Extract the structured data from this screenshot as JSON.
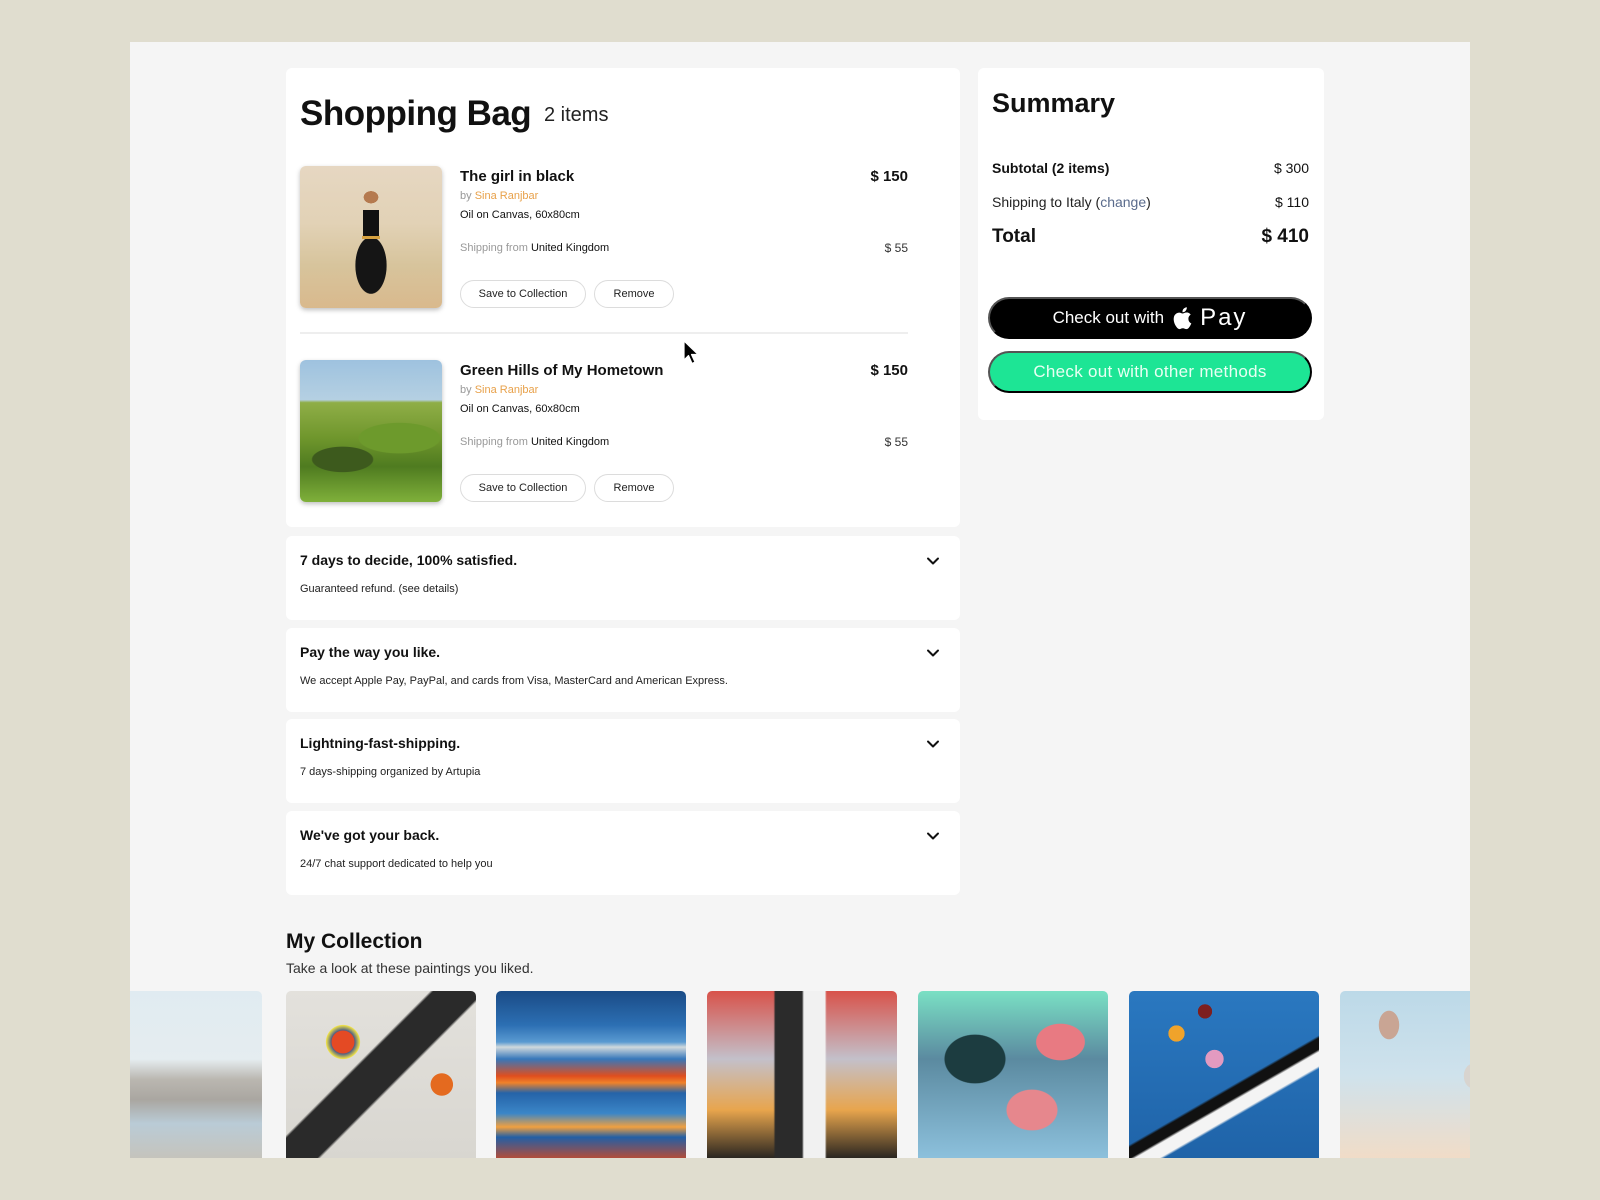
{
  "bag": {
    "title": "Shopping Bag",
    "count": "2 items",
    "items": [
      {
        "title": "The girl in black",
        "by": "by",
        "artist": "Sina Ranjbar",
        "medium": "Oil on Canvas, 60x80cm",
        "shipping_prefix": "Shipping from",
        "shipping_country": "United Kingdom",
        "price": "$ 150",
        "shipping_price": "$ 55",
        "save_label": "Save to Collection",
        "remove_label": "Remove"
      },
      {
        "title": "Green Hills of My Hometown",
        "by": "by",
        "artist": "Sina Ranjbar",
        "medium": "Oil on Canvas, 60x80cm",
        "shipping_prefix": "Shipping from",
        "shipping_country": "United Kingdom",
        "price": "$ 150",
        "shipping_price": "$ 55",
        "save_label": "Save to Collection",
        "remove_label": "Remove"
      }
    ]
  },
  "info": [
    {
      "title": "7 days to decide, 100% satisfied.",
      "desc": "Guaranteed refund. (see details)"
    },
    {
      "title": "Pay the way you like.",
      "desc": "We accept Apple Pay, PayPal, and cards from Visa, MasterCard and American Express."
    },
    {
      "title": "Lightning-fast-shipping.",
      "desc": "7 days-shipping organized by Artupia"
    },
    {
      "title": "We've got your back.",
      "desc": "24/7 chat support dedicated to help you"
    }
  ],
  "summary": {
    "title": "Summary",
    "subtotal_label": "Subtotal (2 items)",
    "subtotal_value": "$ 300",
    "shipping_label": "Shipping to Italy",
    "change_label": "change",
    "shipping_value": "$ 110",
    "total_label": "Total",
    "total_value": "$ 410",
    "applepay_prefix": "Check out with",
    "applepay_word": "Pay",
    "other_methods_label": "Check out with other methods"
  },
  "collection": {
    "title": "My Collection",
    "subtitle": "Take a look at these paintings you liked.",
    "paintings": [
      "seaside-groynes",
      "abstract-figures",
      "striped-sunset",
      "fashion-figures",
      "abstract-clouds",
      "bicycle-flowers",
      "hot-air-balloons"
    ]
  },
  "colors": {
    "background": "#e0ddcf",
    "artist_accent": "#e8a14a",
    "link": "#5a6b8c",
    "applepay_button": "#000000",
    "other_methods_button": "#1de595"
  }
}
